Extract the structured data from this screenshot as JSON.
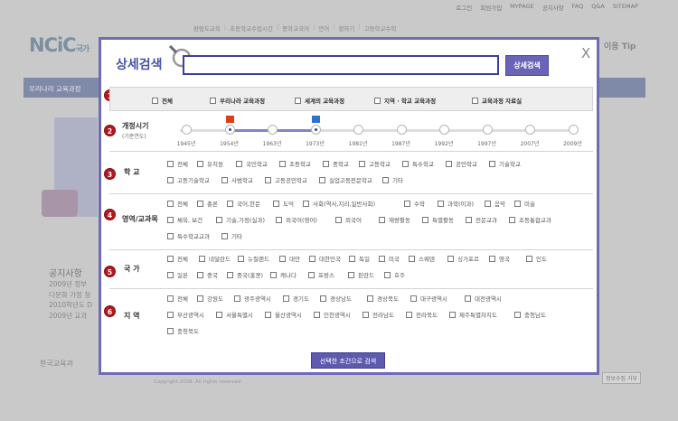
{
  "background": {
    "top_links": [
      "로그인",
      "회원가입",
      "MYPAGE",
      "공지사항",
      "FAQ",
      "Q&A",
      "SITEMAP"
    ],
    "top_nav": [
      "편람도교육",
      "초등학교수업시간",
      "중학교국어",
      "먼어",
      "할하기",
      "고등학교수학"
    ],
    "logo_text": "NCiC",
    "logo_sub": "국가",
    "tip_text": "이용 Tip",
    "main_nav_label": "우리나라 교육과정",
    "notice_title": "공지사항",
    "notice_lines": [
      "2009년 정부",
      "다문화 가정 청",
      "2010학년도 D",
      "2009년 교과"
    ],
    "footer_logo": "한국교육과",
    "footer_copy": "Copyright 2008. All rights reserved.",
    "footer_button": "정보수집 거부"
  },
  "modal": {
    "title": "상세검색",
    "search_value": "",
    "search_button": "상세검색",
    "close_label": "X",
    "apply_button": "선택한 조건으로 검색",
    "section1": {
      "badge": "1",
      "options": [
        "전체",
        "우리나라 교육과정",
        "세계의 교육과정",
        "지역 · 학교 교육과정",
        "교육과정 자료실"
      ]
    },
    "section2": {
      "badge": "2",
      "label": "개정시기",
      "sublabel": "(기준연도)",
      "years": [
        "1945년",
        "1954년",
        "1963년",
        "1973년",
        "1981년",
        "1987년",
        "1992년",
        "1997년",
        "2007년",
        "2009년"
      ],
      "selected": [
        "1954년",
        "1973년"
      ],
      "range_fraction": [
        0.111,
        0.333
      ]
    },
    "section3": {
      "badge": "3",
      "label": "학  교",
      "rows": [
        [
          "전체",
          "유치원",
          "국민학교",
          "초등학교",
          "중학교",
          "고등학교",
          "특수학교",
          "공민학교",
          "기술학교"
        ],
        [
          "고등기술학교",
          "사범학교",
          "고등공민학교",
          "실업고등전문학교",
          "기타"
        ]
      ]
    },
    "section4": {
      "badge": "4",
      "label": "영역/교과목",
      "rows": [
        [
          "전체",
          "총론",
          "국어,한문",
          "도덕",
          "사회(역사,지리,일반사회)",
          "수학",
          "과학(이과)",
          "음악",
          "미술"
        ],
        [
          "체육, 보건",
          "기술,가정(실과)",
          "외국어(영어)",
          "외국어",
          "재량활동",
          "특별활동",
          "전문교과",
          "초등통합교과"
        ],
        [
          "특수학교교과",
          "기타"
        ]
      ]
    },
    "section5": {
      "badge": "5",
      "label": "국  가",
      "rows": [
        [
          "전체",
          "네덜란드",
          "뉴질랜드",
          "대만",
          "대한민국",
          "독일",
          "미국",
          "스웨덴",
          "싱가포르",
          "영국",
          "인도"
        ],
        [
          "일본",
          "중국",
          "중국(홍콩)",
          "캐나다",
          "프랑스",
          "핀란드",
          "호주"
        ]
      ]
    },
    "section6": {
      "badge": "6",
      "label": "지  역",
      "rows": [
        [
          "전체",
          "강원도",
          "광주광역시",
          "경기도",
          "경상남도",
          "경상북도",
          "대구광역시",
          "대전광역시"
        ],
        [
          "부산광역시",
          "서울특별시",
          "울산광역시",
          "인천광역시",
          "전라남도",
          "전라북도",
          "제주특별자치도",
          "충청남도"
        ],
        [
          "충청북도"
        ]
      ]
    }
  },
  "colors": {
    "accent": "#6f6bb8",
    "badge": "#b3181e",
    "button": "#6a64b7"
  }
}
